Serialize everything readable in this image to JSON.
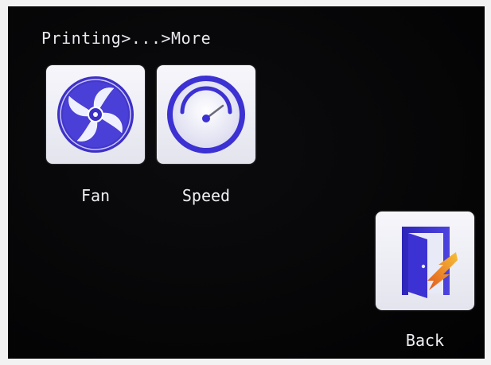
{
  "breadcrumb": "Printing>...>More",
  "tiles": [
    {
      "label": "Fan",
      "icon": "fan-icon"
    },
    {
      "label": "Speed",
      "icon": "speedometer-icon"
    }
  ],
  "back": {
    "label": "Back",
    "icon": "exit-door-icon"
  },
  "colors": {
    "screen_bg": "#050506",
    "tile_bg": "#eeeef6",
    "icon_primary": "#4a3fd6",
    "icon_accent": "#e2861e",
    "text": "#f0f0f4"
  }
}
